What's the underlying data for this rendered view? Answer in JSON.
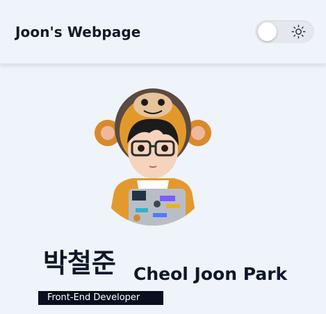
{
  "header": {
    "title": "Joon's Webpage",
    "theme_toggle": {
      "mode": "light",
      "icon": "sun-icon"
    }
  },
  "profile": {
    "avatar": "avatar-illustration",
    "name_korean": "박철준",
    "name_english": "Cheol Joon Park",
    "role": "Front-End Developer"
  },
  "colors": {
    "background": "#eff4fb",
    "toggle_track": "#e4e8ee",
    "badge_bg": "#0a0f1f",
    "text": "#0f172a"
  }
}
